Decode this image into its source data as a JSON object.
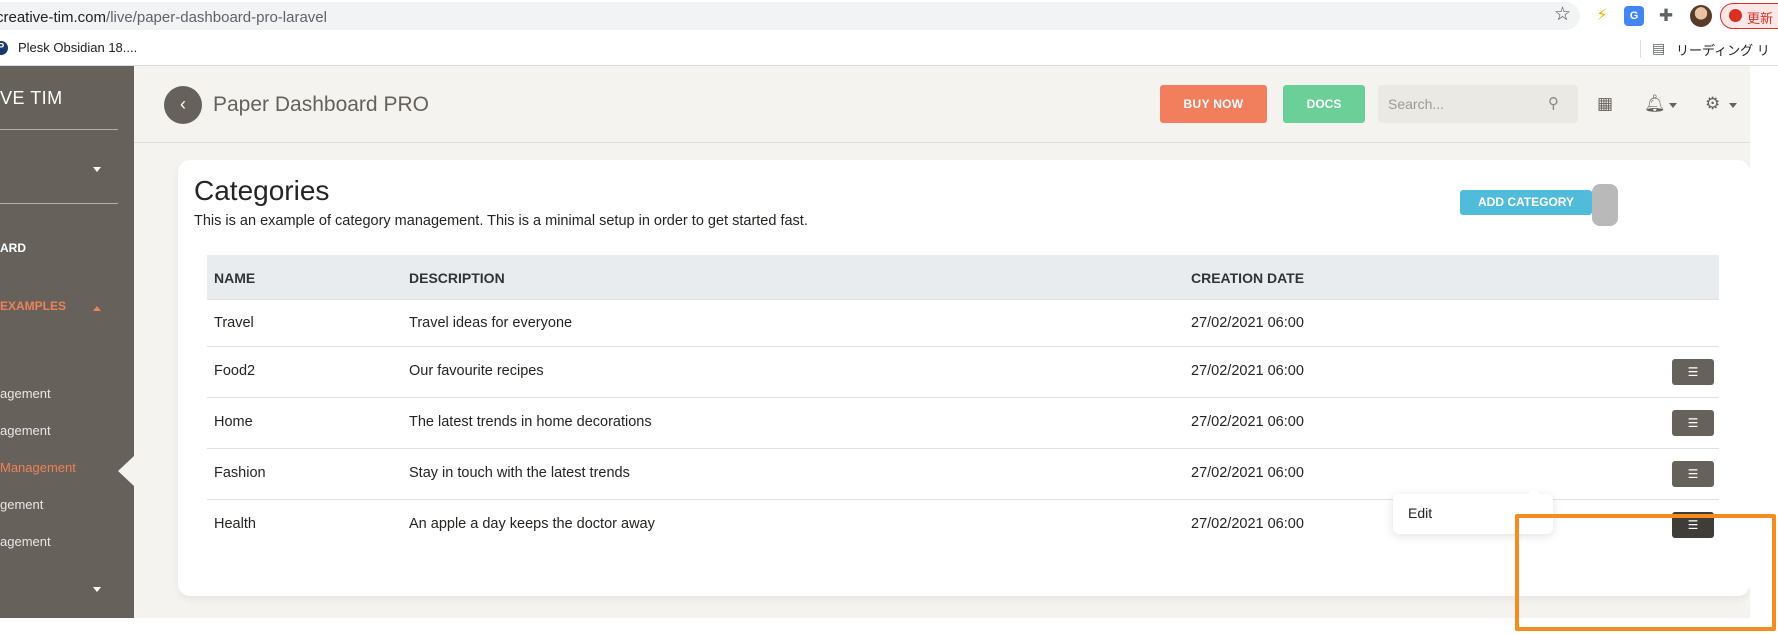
{
  "browser": {
    "url_domain": "creative-tim.com",
    "url_path": "/live/paper-dashboard-pro-laravel",
    "bookmark": "Plesk Obsidian 18....",
    "reading_list": "リーディング リ",
    "update_button": "更新"
  },
  "sidebar": {
    "brand": "VE TIM",
    "items": [
      {
        "label": "ARD"
      },
      {
        "label": "EXAMPLES"
      }
    ],
    "subitems": [
      {
        "label": "agement"
      },
      {
        "label": "agement"
      },
      {
        "label": "Management"
      },
      {
        "label": "gement"
      },
      {
        "label": "agement"
      }
    ],
    "colors": {
      "background": "#66615b",
      "active": "#ef8157"
    }
  },
  "navbar": {
    "title": "Paper Dashboard PRO",
    "buy_now": "BUY NOW",
    "docs": "DOCS",
    "search_placeholder": "Search...",
    "colors": {
      "buy_now": "#f17e5d",
      "docs": "#6bd098"
    }
  },
  "card": {
    "title": "Categories",
    "description": "This is an example of category management. This is a minimal setup in order to get started fast.",
    "add_button": "ADD CATEGORY",
    "table": {
      "headers": [
        "NAME",
        "DESCRIPTION",
        "CREATION DATE"
      ],
      "rows": [
        {
          "name": "Travel",
          "description": "Travel ideas for everyone",
          "date": "27/02/2021 06:00"
        },
        {
          "name": "Food2",
          "description": "Our favourite recipes",
          "date": "27/02/2021 06:00"
        },
        {
          "name": "Home",
          "description": "The latest trends in home decorations",
          "date": "27/02/2021 06:00"
        },
        {
          "name": "Fashion",
          "description": "Stay in touch with the latest trends",
          "date": "27/02/2021 06:00"
        },
        {
          "name": "Health",
          "description": "An apple a day keeps the doctor away",
          "date": "27/02/2021 06:00"
        }
      ]
    },
    "dropdown": {
      "items": [
        "Edit"
      ]
    }
  }
}
